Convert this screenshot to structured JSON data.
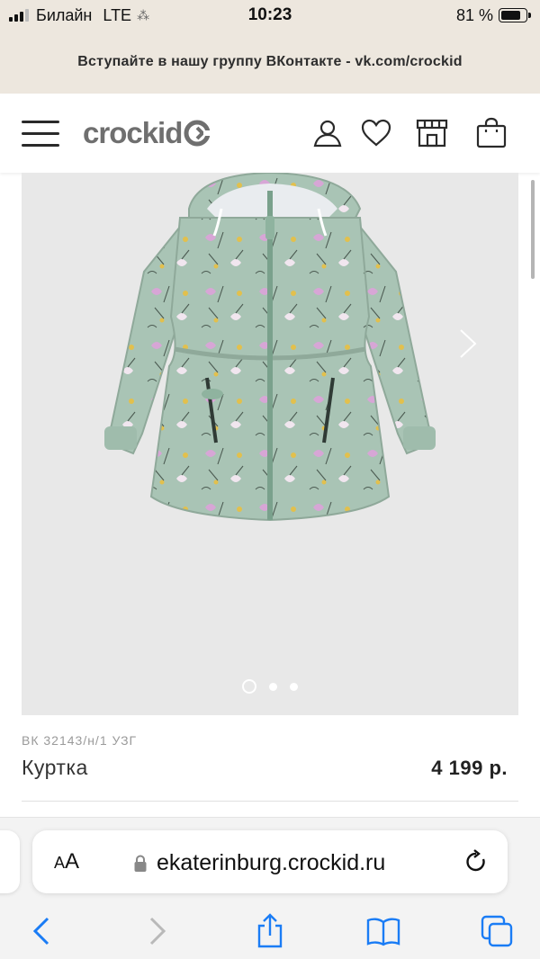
{
  "status_bar": {
    "carrier": "Билайн",
    "network": "LTE",
    "activity": "⁂",
    "time": "10:23",
    "battery": "81 %",
    "battery_level": 0.81
  },
  "promo_banner": {
    "text": "Вступайте в нашу группу ВКонтакте - vk.com/crockid"
  },
  "header": {
    "logo_text": "crockid",
    "icons": [
      "menu-icon",
      "user-icon",
      "heart-icon",
      "store-icon",
      "shopping-bag-icon"
    ]
  },
  "gallery": {
    "slides_count": 3,
    "active_slide": 1,
    "image_subject": "jacket-mint-floral"
  },
  "product": {
    "sku": "ВК 32143/н/1 УЗГ",
    "title": "Куртка",
    "price": "4 199 р."
  },
  "browser": {
    "text_size_label": "AA",
    "url": "ekaterinburg.crockid.ru",
    "icons": [
      "lock-icon",
      "reload-icon",
      "back-icon",
      "forward-icon",
      "share-icon",
      "bookmarks-icon",
      "tabs-icon"
    ]
  },
  "colors": {
    "banner_bg": "#ede7de",
    "logo_gray": "#6f6f6f",
    "gallery_bg": "#e8e8e8",
    "jacket_mint": "#a9c4b5",
    "safari_blue": "#1a7cf5"
  }
}
